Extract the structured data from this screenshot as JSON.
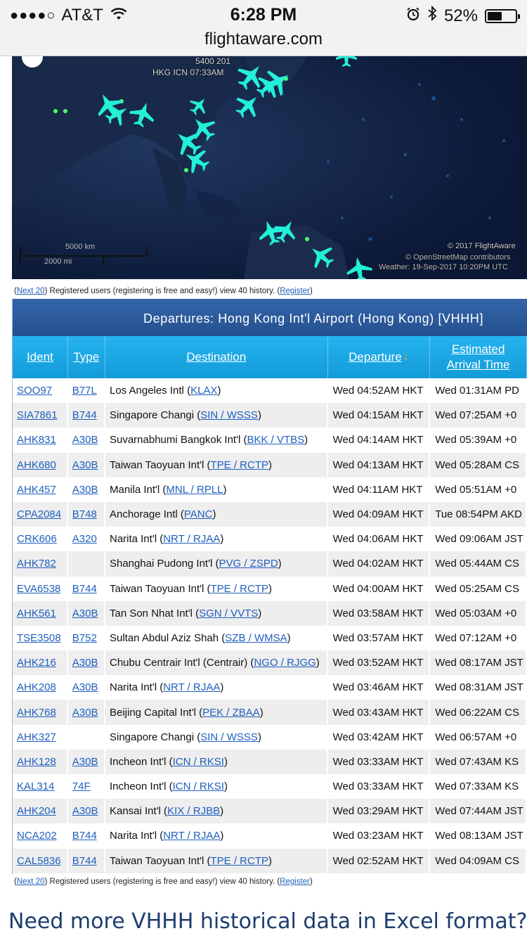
{
  "status_bar": {
    "signal": "●●●●○",
    "carrier": "AT&T",
    "time": "6:28 PM",
    "battery_percent": "52%",
    "battery_level": 0.52,
    "url": "flightaware.com"
  },
  "map": {
    "flight_label_line1": "5400 201",
    "flight_label_line2": "HKG ICN 07:33AM",
    "scale_km": "5000 km",
    "scale_mi": "2000 mi",
    "credit_line1": "© 2017 FlightAware",
    "credit_line2": "© OpenStreetMap contributors",
    "credit_line3": "Weather: 19-Sep-2017 10:20PM UTC"
  },
  "note_top": {
    "open": "(",
    "next": "Next 20",
    "middle": ") Registered users (registering is free and easy!) view 40 history. (",
    "register": "Register",
    "close": ")"
  },
  "note_bottom": {
    "open": "(",
    "next": "Next 20",
    "middle": ") Registered users (registering is free and easy!) view 40 history. (",
    "register": "Register",
    "close": ")"
  },
  "board": {
    "title": "Departures: Hong Kong Int'l Airport (Hong Kong) [VHHH]",
    "headers": {
      "ident": "Ident",
      "type": "Type",
      "destination": "Destination",
      "departure": "Departure",
      "arrival_line1": "Estimated",
      "arrival_line2": "Arrival Time"
    },
    "rows": [
      {
        "ident": "SOO97",
        "type": "B77L",
        "dest_name": "Los Angeles Intl",
        "dest_code": "KLAX",
        "departure": "Wed 04:52AM HKT",
        "arrival": "Wed 01:31AM PD"
      },
      {
        "ident": "SIA7861",
        "type": "B744",
        "dest_name": "Singapore Changi",
        "dest_code": "SIN / WSSS",
        "departure": "Wed 04:15AM HKT",
        "arrival": "Wed 07:25AM +0"
      },
      {
        "ident": "AHK831",
        "type": "A30B",
        "dest_name": "Suvarnabhumi Bangkok Int'l",
        "dest_code": "BKK / VTBS",
        "departure": "Wed 04:14AM HKT",
        "arrival": "Wed 05:39AM +0"
      },
      {
        "ident": "AHK680",
        "type": "A30B",
        "dest_name": "Taiwan Taoyuan Int'l",
        "dest_code": "TPE / RCTP",
        "departure": "Wed 04:13AM HKT",
        "arrival": "Wed 05:28AM CS"
      },
      {
        "ident": "AHK457",
        "type": "A30B",
        "dest_name": "Manila Int'l",
        "dest_code": "MNL / RPLL",
        "departure": "Wed 04:11AM HKT",
        "arrival": "Wed 05:51AM +0"
      },
      {
        "ident": "CPA2084",
        "type": "B748",
        "dest_name": "Anchorage Intl",
        "dest_code": "PANC",
        "departure": "Wed 04:09AM HKT",
        "arrival": "Tue 08:54PM AKD"
      },
      {
        "ident": "CRK606",
        "type": "A320",
        "dest_name": "Narita Int'l",
        "dest_code": "NRT / RJAA",
        "departure": "Wed 04:06AM HKT",
        "arrival": "Wed 09:06AM JST"
      },
      {
        "ident": "AHK782",
        "type": "",
        "dest_name": "Shanghai Pudong Int'l",
        "dest_code": "PVG / ZSPD",
        "departure": "Wed 04:02AM HKT",
        "arrival": "Wed 05:44AM CS"
      },
      {
        "ident": "EVA6538",
        "type": "B744",
        "dest_name": "Taiwan Taoyuan Int'l",
        "dest_code": "TPE / RCTP",
        "departure": "Wed 04:00AM HKT",
        "arrival": "Wed 05:25AM CS"
      },
      {
        "ident": "AHK561",
        "type": "A30B",
        "dest_name": "Tan Son Nhat Int'l",
        "dest_code": "SGN / VVTS",
        "departure": "Wed 03:58AM HKT",
        "arrival": "Wed 05:03AM +0"
      },
      {
        "ident": "TSE3508",
        "type": "B752",
        "dest_name": "Sultan Abdul Aziz Shah",
        "dest_code": "SZB / WMSA",
        "departure": "Wed 03:57AM HKT",
        "arrival": "Wed 07:12AM +0"
      },
      {
        "ident": "AHK216",
        "type": "A30B",
        "dest_name": "Chubu Centrair Int'l (Centrair)",
        "dest_code": "NGO / RJGG",
        "departure": "Wed 03:52AM HKT",
        "arrival": "Wed 08:17AM JST"
      },
      {
        "ident": "AHK208",
        "type": "A30B",
        "dest_name": "Narita Int'l",
        "dest_code": "NRT / RJAA",
        "departure": "Wed 03:46AM HKT",
        "arrival": "Wed 08:31AM JST"
      },
      {
        "ident": "AHK768",
        "type": "A30B",
        "dest_name": "Beijing Capital Int'l",
        "dest_code": "PEK / ZBAA",
        "departure": "Wed 03:43AM HKT",
        "arrival": "Wed 06:22AM CS"
      },
      {
        "ident": "AHK327",
        "type": "",
        "dest_name": "Singapore Changi",
        "dest_code": "SIN / WSSS",
        "departure": "Wed 03:42AM HKT",
        "arrival": "Wed 06:57AM +0"
      },
      {
        "ident": "AHK128",
        "type": "A30B",
        "dest_name": "Incheon Int'l",
        "dest_code": "ICN / RKSI",
        "departure": "Wed 03:33AM HKT",
        "arrival": "Wed 07:43AM KS"
      },
      {
        "ident": "KAL314",
        "type": "74F",
        "dest_name": "Incheon Int'l",
        "dest_code": "ICN / RKSI",
        "departure": "Wed 03:33AM HKT",
        "arrival": "Wed 07:33AM KS"
      },
      {
        "ident": "AHK204",
        "type": "A30B",
        "dest_name": "Kansai Int'l",
        "dest_code": "KIX / RJBB",
        "departure": "Wed 03:29AM HKT",
        "arrival": "Wed 07:44AM JST"
      },
      {
        "ident": "NCA202",
        "type": "B744",
        "dest_name": "Narita Int'l",
        "dest_code": "NRT / RJAA",
        "departure": "Wed 03:23AM HKT",
        "arrival": "Wed 08:13AM JST"
      },
      {
        "ident": "CAL5836",
        "type": "B744",
        "dest_name": "Taiwan Taoyuan Int'l",
        "dest_code": "TPE / RCTP",
        "departure": "Wed 02:52AM HKT",
        "arrival": "Wed 04:09AM CS"
      }
    ]
  },
  "promo": {
    "heading": "Need more VHHH historical data in Excel format?"
  },
  "colors": {
    "board_title_bg": "#2a5595",
    "header_bg": "#1aa7e6",
    "link": "#1f5fbf",
    "sort_arrow": "#f7941d",
    "plane": "#22f0d8",
    "promo_text": "#1d3d6e"
  }
}
